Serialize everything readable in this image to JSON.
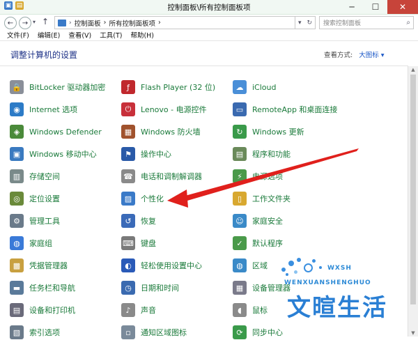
{
  "window": {
    "title": "控制面板\\所有控制面板项",
    "minimize": "─",
    "maximize": "☐",
    "close": "✕"
  },
  "address": {
    "segments": [
      "控制面板",
      "›",
      "所有控制面板项",
      "›"
    ],
    "dropdown": "▾",
    "refresh": "↻",
    "search_placeholder": "搜索控制面板"
  },
  "menu": [
    "文件(F)",
    "编辑(E)",
    "查看(V)",
    "工具(T)",
    "帮助(H)"
  ],
  "header": {
    "title": "调整计算机的设置",
    "view_by_label": "查看方式:",
    "view_by_value": "大图标 ▾"
  },
  "items": [
    {
      "label": "BitLocker 驱动器加密",
      "icon": "bitlocker-icon",
      "color": "#8a8f99"
    },
    {
      "label": "Flash Player (32 位)",
      "icon": "flash-icon",
      "color": "#c0282d"
    },
    {
      "label": "iCloud",
      "icon": "icloud-icon",
      "color": "#4a8fd8"
    },
    {
      "label": "Internet 选项",
      "icon": "internet-icon",
      "color": "#2c7bc7"
    },
    {
      "label": "Lenovo - 电源控件",
      "icon": "lenovo-power-icon",
      "color": "#c8303a"
    },
    {
      "label": "RemoteApp 和桌面连接",
      "icon": "remoteapp-icon",
      "color": "#3a6ab0"
    },
    {
      "label": "Windows Defender",
      "icon": "defender-icon",
      "color": "#4a8a3a"
    },
    {
      "label": "Windows 防火墙",
      "icon": "firewall-icon",
      "color": "#a0522d"
    },
    {
      "label": "Windows 更新",
      "icon": "update-icon",
      "color": "#3a9a4a"
    },
    {
      "label": "Windows 移动中心",
      "icon": "mobility-icon",
      "color": "#3a7ac0"
    },
    {
      "label": "操作中心",
      "icon": "action-center-icon",
      "color": "#2a5aa8"
    },
    {
      "label": "程序和功能",
      "icon": "programs-icon",
      "color": "#6a8a5a"
    },
    {
      "label": "存储空间",
      "icon": "storage-icon",
      "color": "#7a8a8a"
    },
    {
      "label": "电话和调制解调器",
      "icon": "phone-modem-icon",
      "color": "#8a8a8a"
    },
    {
      "label": "电源选项",
      "icon": "power-icon",
      "color": "#4a9a4a"
    },
    {
      "label": "定位设置",
      "icon": "location-icon",
      "color": "#6a8a3a"
    },
    {
      "label": "个性化",
      "icon": "personalization-icon",
      "color": "#3a7ac8"
    },
    {
      "label": "工作文件夹",
      "icon": "work-folders-icon",
      "color": "#d8a830"
    },
    {
      "label": "管理工具",
      "icon": "admin-tools-icon",
      "color": "#6a7a8a"
    },
    {
      "label": "恢复",
      "icon": "recovery-icon",
      "color": "#3a6ab8"
    },
    {
      "label": "家庭安全",
      "icon": "family-safety-icon",
      "color": "#3a8ac8"
    },
    {
      "label": "家庭组",
      "icon": "homegroup-icon",
      "color": "#3a7ad8"
    },
    {
      "label": "键盘",
      "icon": "keyboard-icon",
      "color": "#7a7a7a"
    },
    {
      "label": "默认程序",
      "icon": "default-programs-icon",
      "color": "#4a9a4a"
    },
    {
      "label": "凭据管理器",
      "icon": "credential-icon",
      "color": "#c8a040"
    },
    {
      "label": "轻松使用设置中心",
      "icon": "ease-of-access-icon",
      "color": "#2a5ab8"
    },
    {
      "label": "区域",
      "icon": "region-icon",
      "color": "#3a8ac8"
    },
    {
      "label": "任务栏和导航",
      "icon": "taskbar-icon",
      "color": "#5a7a9a"
    },
    {
      "label": "日期和时间",
      "icon": "datetime-icon",
      "color": "#3a6ab0"
    },
    {
      "label": "设备管理器",
      "icon": "device-manager-icon",
      "color": "#7a7a8a"
    },
    {
      "label": "设备和打印机",
      "icon": "printer-icon",
      "color": "#6a6a7a"
    },
    {
      "label": "声音",
      "icon": "sound-icon",
      "color": "#8a8a8a"
    },
    {
      "label": "鼠标",
      "icon": "mouse-icon",
      "color": "#8a8a8a"
    },
    {
      "label": "索引选项",
      "icon": "indexing-icon",
      "color": "#6a7a8a"
    },
    {
      "label": "通知区域图标",
      "icon": "notification-icon",
      "color": "#7a8a9a"
    },
    {
      "label": "同步中心",
      "icon": "sync-icon",
      "color": "#3a9a4a"
    }
  ],
  "watermark": {
    "brand_line": "WXSH",
    "sub_line": "WENXUANSHENGHUO",
    "main": "文暄生活"
  },
  "colors": {
    "link": "#1a7a3a",
    "title": "#1e3287",
    "arrow": "#e0201c",
    "watermark": "#2a7fd4"
  }
}
